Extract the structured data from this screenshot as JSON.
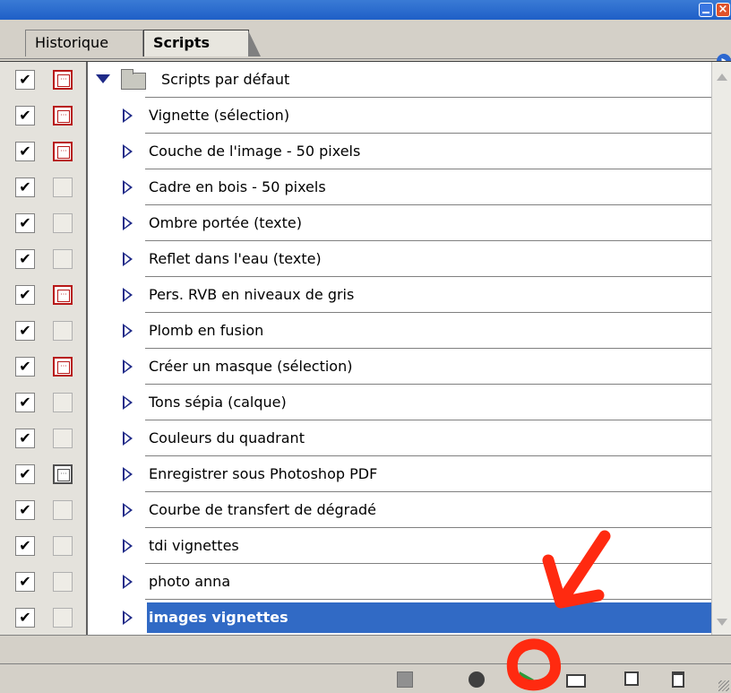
{
  "tabs": [
    {
      "label": "Historique",
      "active": false
    },
    {
      "label": "Scripts",
      "active": true
    }
  ],
  "folder": {
    "label": "Scripts par défaut",
    "checked": "✔"
  },
  "scripts": [
    {
      "label": "Vignette (sélection)",
      "checked": "✔",
      "dialog": "red"
    },
    {
      "label": "Couche de l'image - 50 pixels",
      "checked": "✔",
      "dialog": "red"
    },
    {
      "label": "Cadre en bois - 50 pixels",
      "checked": "✔",
      "dialog": "none"
    },
    {
      "label": "Ombre portée (texte)",
      "checked": "✔",
      "dialog": "none"
    },
    {
      "label": "Reflet dans l'eau (texte)",
      "checked": "✔",
      "dialog": "none"
    },
    {
      "label": "Pers. RVB en niveaux de gris",
      "checked": "✔",
      "dialog": "red"
    },
    {
      "label": "Plomb en fusion",
      "checked": "✔",
      "dialog": "none"
    },
    {
      "label": "Créer un masque (sélection)",
      "checked": "✔",
      "dialog": "red"
    },
    {
      "label": "Tons sépia (calque)",
      "checked": "✔",
      "dialog": "none"
    },
    {
      "label": "Couleurs du quadrant",
      "checked": "✔",
      "dialog": "none"
    },
    {
      "label": "Enregistrer sous Photoshop PDF",
      "checked": "✔",
      "dialog": "grey"
    },
    {
      "label": "Courbe de transfert de dégradé",
      "checked": "✔",
      "dialog": "none"
    },
    {
      "label": "tdi vignettes",
      "checked": "✔",
      "dialog": "none"
    },
    {
      "label": "photo anna",
      "checked": "✔",
      "dialog": "none"
    },
    {
      "label": "images vignettes",
      "checked": "✔",
      "dialog": "none",
      "selected": true
    }
  ],
  "toolbar": {
    "stop": "stop-icon",
    "record": "record-icon",
    "play": "play-icon",
    "new_set": "folder-icon",
    "new_action": "new-icon",
    "delete": "trash-icon"
  },
  "colors": {
    "selection": "#316ac5",
    "dialog_on": "#b81818",
    "play": "#2b9a3a",
    "annotation": "#ff2a10",
    "titlebar": "#2a6ad0"
  }
}
